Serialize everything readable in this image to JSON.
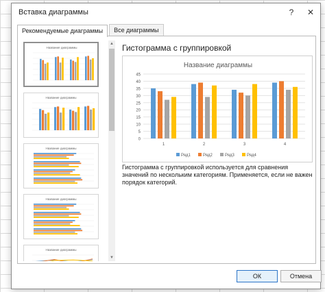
{
  "dialog": {
    "title": "Вставка диаграммы",
    "help_glyph": "?",
    "close_glyph": "✕"
  },
  "tabs": [
    {
      "label": "Рекомендуемые диаграммы",
      "active": true
    },
    {
      "label": "Все диаграммы",
      "active": false
    }
  ],
  "main": {
    "chart_type_title": "Гистограмма с группировкой",
    "description": "Гистограмма с группировкой используется для сравнения значений по нескольким категориям. Применяется, если не важен порядок категорий."
  },
  "chart_data": {
    "type": "bar",
    "title": "Название диаграммы",
    "categories": [
      "1",
      "2",
      "3",
      "4"
    ],
    "ylim": [
      0,
      45
    ],
    "yticks": [
      0,
      5,
      10,
      15,
      20,
      25,
      30,
      35,
      40,
      45
    ],
    "grid": true,
    "legend_position": "bottom",
    "series": [
      {
        "name": "Ряд1",
        "color": "#5b9bd5",
        "values": [
          35,
          38,
          34,
          39
        ]
      },
      {
        "name": "Ряд2",
        "color": "#ed7d31",
        "values": [
          33,
          39,
          32,
          40
        ]
      },
      {
        "name": "Ряд3",
        "color": "#a5a5a5",
        "values": [
          27,
          29,
          30,
          34
        ]
      },
      {
        "name": "Ряд4",
        "color": "#ffc000",
        "values": [
          29,
          37,
          38,
          36
        ]
      }
    ]
  },
  "thumbnails": [
    {
      "title": "Название диаграммы",
      "kind": "column",
      "selected": true
    },
    {
      "title": "Название диаграммы",
      "kind": "column-wide",
      "selected": false
    },
    {
      "title": "Название диаграммы",
      "kind": "bar",
      "selected": false
    },
    {
      "title": "Название диаграммы",
      "kind": "bar-stacked",
      "selected": false
    },
    {
      "title": "Название диаграммы",
      "kind": "line",
      "selected": false
    }
  ],
  "footer": {
    "ok_label": "ОК",
    "cancel_label": "Отмена"
  }
}
